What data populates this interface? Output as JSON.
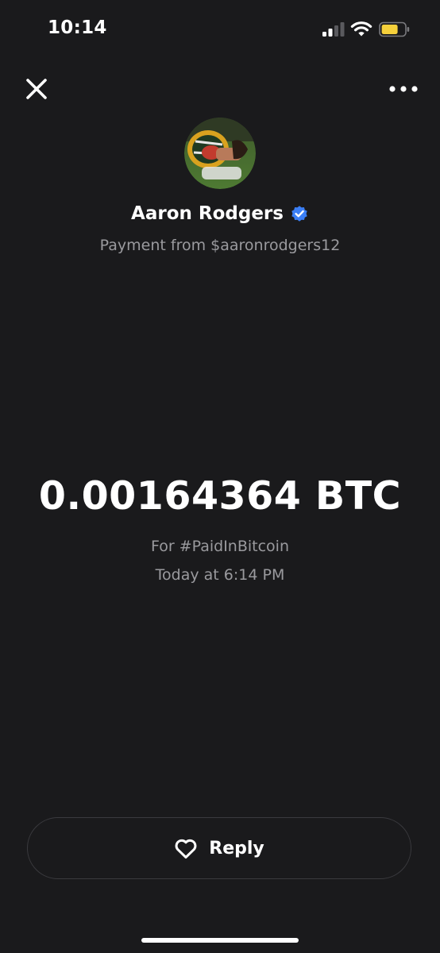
{
  "status_bar": {
    "time": "10:14",
    "signal_icon": "cellular-signal-icon",
    "wifi_icon": "wifi-icon",
    "battery_icon": "battery-icon",
    "battery_color": "#f5d03b"
  },
  "nav": {
    "close_icon": "close-icon",
    "more_icon": "more-horizontal-icon"
  },
  "profile": {
    "name": "Aaron Rodgers",
    "verified": true,
    "verified_color": "#3b7ff6",
    "subtitle": "Payment from $aaronrodgers12"
  },
  "payment": {
    "amount": "0.00164364 BTC",
    "memo": "For #PaidInBitcoin",
    "timestamp": "Today at 6:14 PM"
  },
  "actions": {
    "reply_label": "Reply",
    "reply_icon": "heart-icon"
  },
  "colors": {
    "background": "#1a1a1c",
    "primary_text": "#ffffff",
    "secondary_text": "#9a9a9e",
    "button_border": "#3a3a3e"
  }
}
